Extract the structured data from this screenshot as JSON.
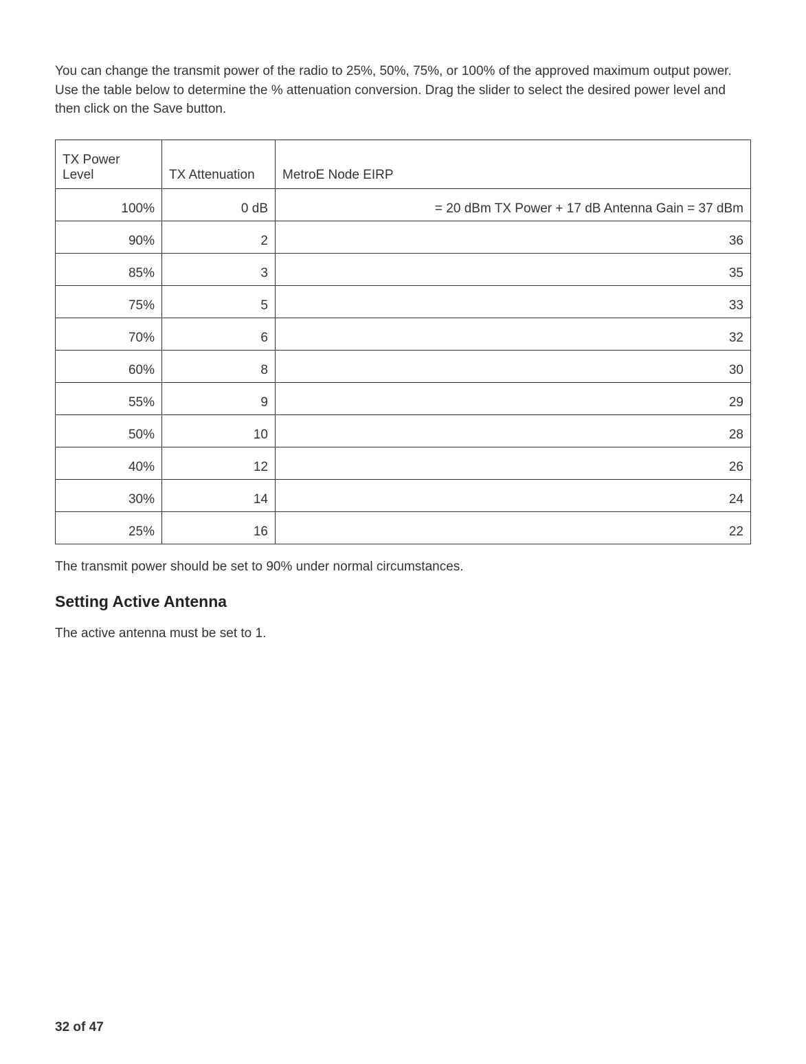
{
  "intro": "You can change the transmit power of the radio to 25%, 50%, 75%, or 100% of the approved maximum output power. Use the table below to determine the % attenuation conversion. Drag the slider to select the desired power level and then click on the Save button.",
  "table": {
    "headers": {
      "power": "TX Power Level",
      "atten": "TX Attenuation",
      "eirp": "MetroE Node EIRP"
    },
    "rows": [
      {
        "power": "100%",
        "atten": "0 dB",
        "eirp": "= 20 dBm TX Power + 17 dB Antenna Gain = 37 dBm"
      },
      {
        "power": "90%",
        "atten": "2",
        "eirp": "36"
      },
      {
        "power": "85%",
        "atten": "3",
        "eirp": "35"
      },
      {
        "power": "75%",
        "atten": "5",
        "eirp": "33"
      },
      {
        "power": "70%",
        "atten": "6",
        "eirp": "32"
      },
      {
        "power": "60%",
        "atten": "8",
        "eirp": "30"
      },
      {
        "power": "55%",
        "atten": "9",
        "eirp": "29"
      },
      {
        "power": "50%",
        "atten": "10",
        "eirp": "28"
      },
      {
        "power": "40%",
        "atten": "12",
        "eirp": "26"
      },
      {
        "power": "30%",
        "atten": "14",
        "eirp": "24"
      },
      {
        "power": "25%",
        "atten": "16",
        "eirp": "22"
      }
    ]
  },
  "after_table": "The transmit power should be set to 90% under normal circumstances.",
  "section_heading": "Setting Active Antenna",
  "antenna_text": "The active antenna must be set to 1.",
  "page_footer": "32 of 47"
}
